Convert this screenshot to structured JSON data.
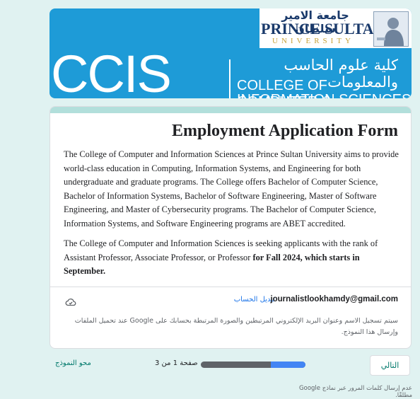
{
  "banner": {
    "college_abbr": "CCIS",
    "college_arabic": "كلية علوم الحاسب والمعلومات",
    "college_english_line1": "COLLEGE OF COMPUTER &",
    "college_english_line2": "INFORMATION SCIENCES",
    "university_arabic": "جامعة الامير سلطان",
    "university_english": "PRINCE SULTAN",
    "university_word": "UNIVERSITY",
    "brand_color": "#1e9bd7"
  },
  "form": {
    "title": "Employment Application Form",
    "paragraph1": "The College of Computer and Information Sciences at Prince Sultan University aims to provide world-class education in Computing, Information Systems, and Engineering for both undergraduate and graduate programs. The College offers Bachelor of Computer Science, Bachelor of Information Systems, Bachelor of Software Engineering, Master of Software Engineering, and Master of Cybersecurity programs. The Bachelor of Computer Science, Information Systems, and Software Engineering programs are ABET accredited.",
    "paragraph2_start": "The College of Computer and Information Sciences is seeking applicants with the rank of Assistant Professor, Associate Professor, or Professor ",
    "paragraph2_bold": "for Fall 2024, which starts in September.",
    "account_email": "journalistlookhamdy@gmail.com",
    "switch_account": "تبديل الحساب",
    "cloud_icon": "cloud-off-icon",
    "notice": "سيتم تسجيل الاسم وعنوان البريد الإلكتروني المرتبطين والصورة المرتبطة بحسابك على Google عند تحميل الملفات وإرسال هذا النموذج."
  },
  "navigation": {
    "next_label": "التالي",
    "page_label": "صفحة 1 من 3",
    "clear_label": "محو النموذج",
    "progress_fraction": 0.3333
  },
  "footer": {
    "note": "عدم إرسال كلمات المرور عبر نماذج Google مطلقًا."
  }
}
